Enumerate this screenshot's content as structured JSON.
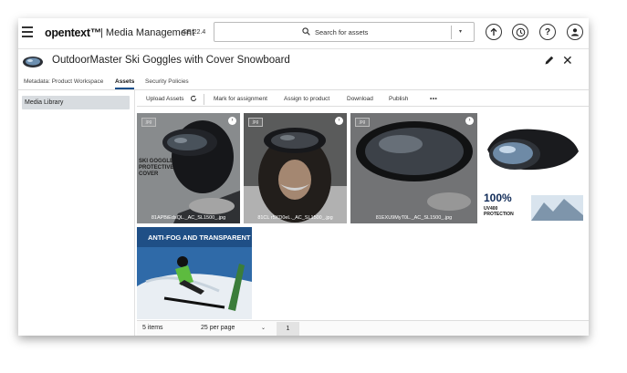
{
  "app": {
    "logo_text": "opentext™",
    "name": "| Media Management",
    "version": "CE 22.4"
  },
  "search": {
    "placeholder": "Search for assets"
  },
  "header_icons": [
    "arrow-up-icon",
    "clock-icon",
    "help-icon",
    "user-icon"
  ],
  "asset": {
    "title": "OutdoorMaster Ski Goggles with Cover Snowboard"
  },
  "tabs": [
    {
      "label": "Metadata: Product Workspace",
      "active": false
    },
    {
      "label": "Assets",
      "active": true
    },
    {
      "label": "Security Policies",
      "active": false
    }
  ],
  "sidebar": {
    "items": [
      {
        "label": "Media Library",
        "selected": true
      }
    ]
  },
  "toolbar": {
    "upload": "Upload Assets",
    "mark": "Mark for assignment",
    "assign": "Assign to product",
    "download": "Download",
    "publish": "Publish",
    "more": "•••"
  },
  "assets": [
    {
      "badge": "jpg",
      "caption": "81APBiEdsQL._AC_SL1500_.jpg",
      "overlay_text": "SKI GOGGLE PROTECTIVE COVER"
    },
    {
      "badge": "jpg",
      "caption": "81CL r5XD0eL._AC_SL1500_.jpg"
    },
    {
      "badge": "jpg",
      "caption": "81EXU9MyT0L._AC_SL1500_.jpg"
    },
    {
      "promo_big": "100%",
      "promo_small": "UV400 PROTECTION"
    },
    {
      "promo_heading": "ANTI-FOG AND TRANSPARENT"
    }
  ],
  "footer": {
    "items_count": "5 items",
    "per_page": "25 per page",
    "page": "1"
  },
  "colors": {
    "accent": "#1a4f8a",
    "sidebar_selected": "#d8dce0"
  }
}
